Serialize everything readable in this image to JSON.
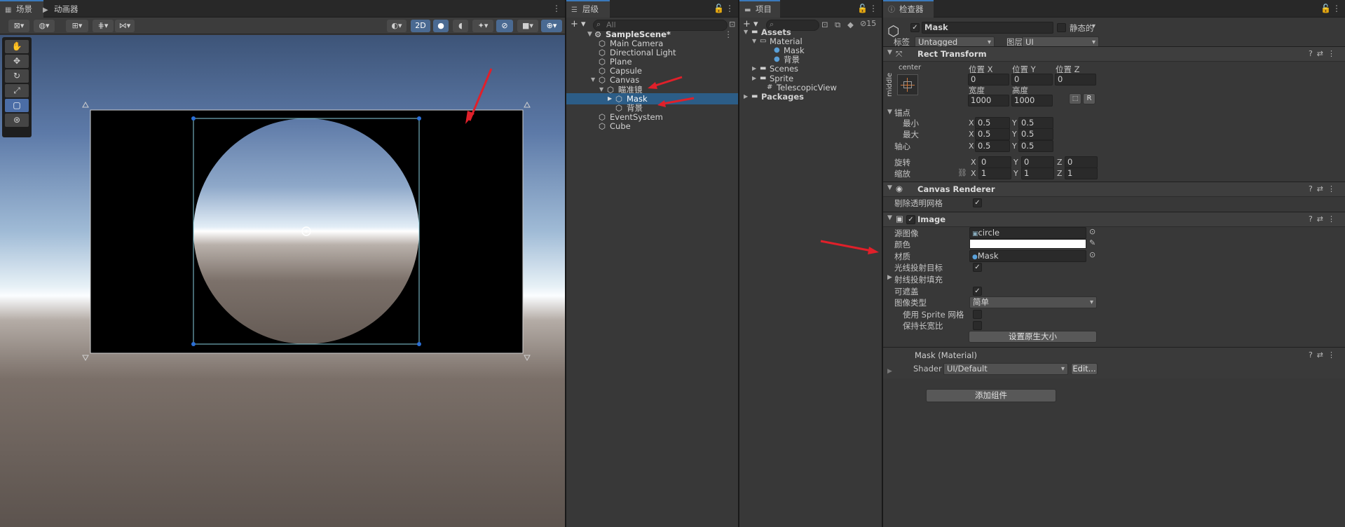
{
  "scene": {
    "tab_scene": "场景",
    "tab_animator": "动画器",
    "btn_2d": "2D"
  },
  "hierarchy": {
    "tab": "层级",
    "search_placeholder": "All",
    "scene_name": "SampleScene*",
    "items": [
      {
        "label": "Main Camera",
        "depth": 1
      },
      {
        "label": "Directional Light",
        "depth": 1
      },
      {
        "label": "Plane",
        "depth": 1
      },
      {
        "label": "Capsule",
        "depth": 1
      },
      {
        "label": "Canvas",
        "depth": 1
      },
      {
        "label": "瞄准镜",
        "depth": 2
      },
      {
        "label": "Mask",
        "depth": 3
      },
      {
        "label": "背景",
        "depth": 3
      },
      {
        "label": "EventSystem",
        "depth": 1
      },
      {
        "label": "Cube",
        "depth": 1
      }
    ]
  },
  "project": {
    "tab": "项目",
    "hidden_count": "15",
    "items": [
      "Assets",
      "Material",
      "Mask",
      "背景",
      "Scenes",
      "Sprite",
      "TelescopicView",
      "Packages"
    ]
  },
  "inspector": {
    "tab": "检查器",
    "object_name": "Mask",
    "static_label": "静态的",
    "tag_label": "标签",
    "tag_value": "Untagged",
    "layer_label": "图层",
    "layer_value": "UI",
    "rect": {
      "title": "Rect Transform",
      "anchor_h": "center",
      "anchor_v": "middle",
      "pos_x_label": "位置 X",
      "pos_y_label": "位置 Y",
      "pos_z_label": "位置 Z",
      "pos_x": "0",
      "pos_y": "0",
      "pos_z": "0",
      "width_label": "宽度",
      "height_label": "高度",
      "width": "1000",
      "height": "1000",
      "r_btn": "R",
      "anchors_label": "锚点",
      "min_label": "最小",
      "max_label": "最大",
      "min_x": "0.5",
      "min_y": "0.5",
      "max_x": "0.5",
      "max_y": "0.5",
      "pivot_label": "轴心",
      "pivot_x": "0.5",
      "pivot_y": "0.5",
      "rot_label": "旋转",
      "rot_x": "0",
      "rot_y": "0",
      "rot_z": "0",
      "scale_label": "缩放",
      "scale_x": "1",
      "scale_y": "1",
      "scale_z": "1"
    },
    "canvas_renderer": {
      "title": "Canvas Renderer",
      "cull_label": "剔除透明网格"
    },
    "image": {
      "title": "Image",
      "source_label": "源图像",
      "source_value": "circle",
      "color_label": "颜色",
      "color_value": "#ffffff",
      "material_label": "材质",
      "material_value": "Mask",
      "raycast_label": "光线投射目标",
      "raycast_padding_label": "射线投射填充",
      "maskable_label": "可遮盖",
      "type_label": "图像类型",
      "type_value": "简单",
      "use_sprite_mesh_label": "使用 Sprite 网格",
      "preserve_aspect_label": "保持长宽比",
      "native_size_btn": "设置原生大小"
    },
    "material": {
      "title": "Mask (Material)",
      "shader_label": "Shader",
      "shader_value": "UI/Default",
      "edit_btn": "Edit..."
    },
    "add_component": "添加组件"
  },
  "colors": {
    "accent": "#3a79bb",
    "selection": "#2c5d87",
    "arrow": "#e0202a"
  }
}
